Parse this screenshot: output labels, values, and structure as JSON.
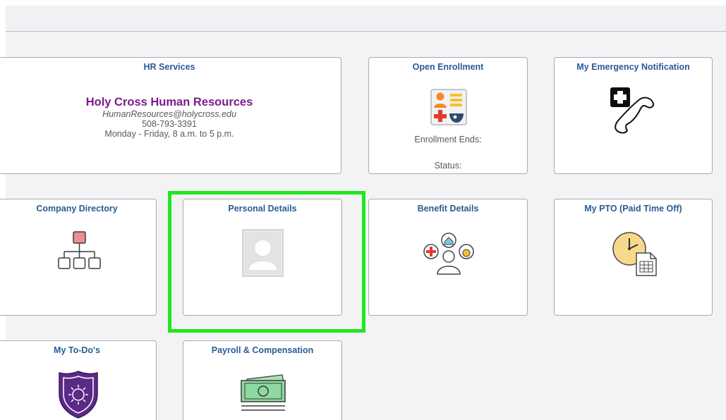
{
  "tiles": {
    "hr_services": {
      "title": "HR Services",
      "name": "Holy Cross Human Resources",
      "email": "HumanResources@holycross.edu",
      "phone": "508-793-3391",
      "hours": "Monday - Friday, 8 a.m. to 5 p.m."
    },
    "open_enrollment": {
      "title": "Open Enrollment",
      "enrollment_ends_label": "Enrollment Ends:",
      "status_label": "Status:"
    },
    "emergency": {
      "title": "My Emergency Notification"
    },
    "company_directory": {
      "title": "Company Directory"
    },
    "personal_details": {
      "title": "Personal Details"
    },
    "benefit_details": {
      "title": "Benefit Details"
    },
    "pto": {
      "title": "My PTO (Paid Time Off)"
    },
    "todo": {
      "title": "My To-Do's"
    },
    "payroll": {
      "title": "Payroll & Compensation"
    }
  },
  "colors": {
    "tile_title": "#2a5b96",
    "hr_name": "#7b1c8c",
    "highlight": "#1ee81e"
  }
}
